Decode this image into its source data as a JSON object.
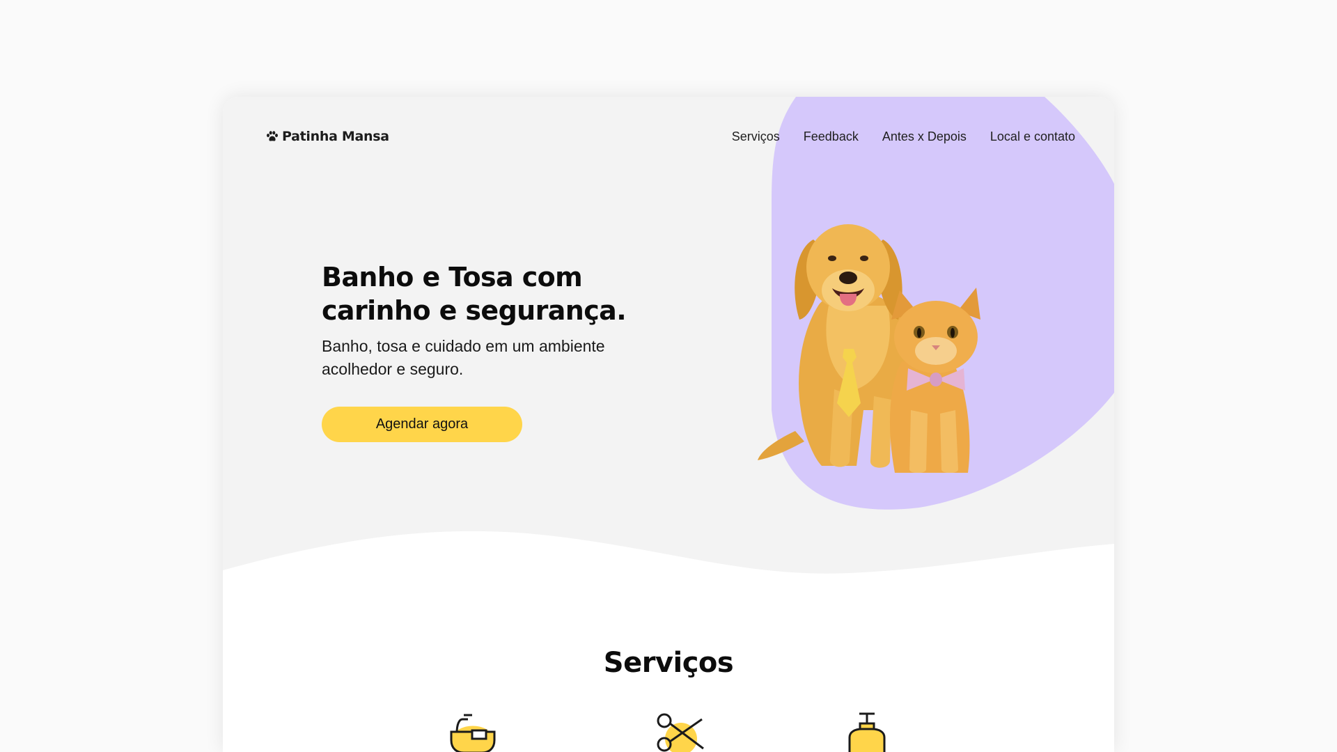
{
  "brand": {
    "name": "Patinha Mansa",
    "logo_icon": "paw-icon"
  },
  "nav": {
    "items": [
      {
        "label": "Serviços"
      },
      {
        "label": "Feedback"
      },
      {
        "label": "Antes x Depois"
      },
      {
        "label": "Local e contato"
      }
    ]
  },
  "hero": {
    "title": "Banho e Tosa com carinho e segurança.",
    "subtitle": "Banho, tosa e cuidado em um ambiente acolhedor e seguro.",
    "cta_label": "Agendar agora",
    "image": "dog-and-cat-illustration"
  },
  "services": {
    "title": "Serviços",
    "icons": [
      "bathtub-icon",
      "scissors-icon",
      "shampoo-bottle-icon"
    ]
  },
  "colors": {
    "accent": "#ffd54a",
    "blob": "#d5c8fb",
    "hero_bg": "#f3f3f3",
    "page_bg": "#fafafa",
    "text": "#0c0c0c"
  }
}
